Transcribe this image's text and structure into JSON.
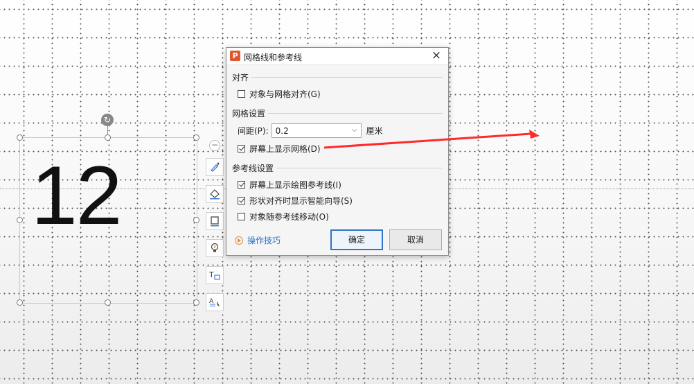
{
  "slide": {
    "number_text": "12"
  },
  "dialog": {
    "title": "网格线和参考线",
    "close_symbol": "×",
    "logo_letter": "P",
    "sections": {
      "align": "对齐",
      "grid": "网格设置",
      "guides": "参考线设置"
    },
    "snap_to_grid": {
      "label": "对象与网格对齐(G)",
      "checked": false
    },
    "spacing": {
      "label": "间距(P):",
      "value": "0.2",
      "unit": "厘米"
    },
    "show_grid": {
      "label": "屏幕上显示网格(D)",
      "checked": true
    },
    "show_drawing_guides": {
      "label": "屏幕上显示绘图参考线(I)",
      "checked": true
    },
    "smart_guides": {
      "label": "形状对齐时显示智能向导(S)",
      "checked": true
    },
    "move_with_guides": {
      "label": "对象随参考线移动(O)",
      "checked": false
    },
    "tips_link": "操作技巧",
    "ok_label": "确定",
    "cancel_label": "取消"
  },
  "colors": {
    "logo": "#e2562f",
    "link": "#2f6fc9",
    "ok_border": "#2f74c8",
    "annotation_arrow": "#ff2a2a"
  }
}
